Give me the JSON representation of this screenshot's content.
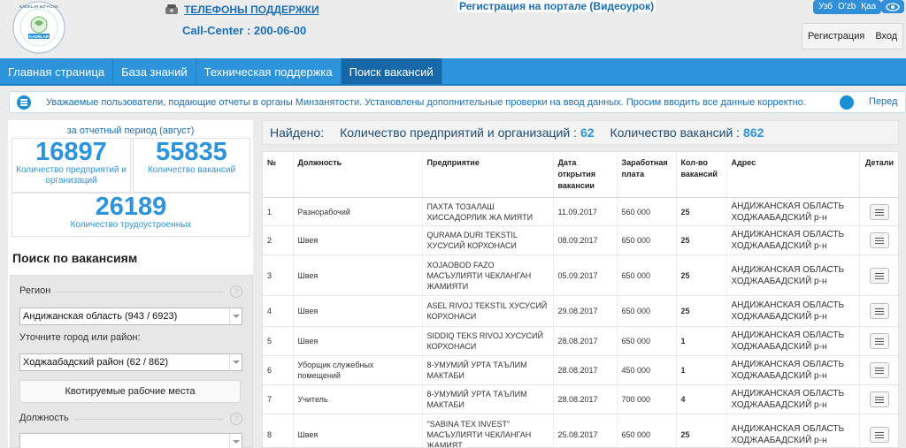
{
  "header": {
    "logo_text_top": "KADRLAR BO'YICHA",
    "logo_text_mid": "KADRLAR",
    "support_link": "ТЕЛЕФОНЫ ПОДДЕРЖКИ",
    "callcenter": "Call-Center : 200-06-00",
    "video_link": "Регистрация на портале (Видеоурок)",
    "langs": [
      "Узб",
      "O'zb",
      "Қаа"
    ],
    "register": "Регистрация",
    "login": "Вход"
  },
  "nav": {
    "items": [
      "Главная страница",
      "База знаний",
      "Техническая поддержка",
      "Поиск вакансий"
    ],
    "active_index": 3
  },
  "notice": {
    "text": "Уважаемые пользователи, подающие отчеты в органы Минзанятости. Установлены дополнительные проверки на ввод данных. Просим вводить все данные корректно.",
    "more": "Перед"
  },
  "stats": {
    "period": "за отчетный период (август)",
    "enterprises_count": "16897",
    "enterprises_label": "Количество предприятий и организаций",
    "vacancies_count": "55835",
    "vacancies_label": "Количество вакансий",
    "employed_count": "26189",
    "employed_label": "Количество трудоустроенных"
  },
  "search": {
    "title": "Поиск по вакансиям",
    "region_label": "Регион",
    "region_value": "Андижанская область (943 / 6923)",
    "city_label": "Уточните город или район:",
    "city_value": "Ходжаабадский район (62 / 862)",
    "quota_button": "Квотируемые рабочие места",
    "position_label": "Должность",
    "position_value": ""
  },
  "found": {
    "label": "Найдено:",
    "enterprises_label": "Количество предприятий и организаций :",
    "enterprises_value": "62",
    "vacancies_label": "Количество вакансий :",
    "vacancies_value": "862"
  },
  "table": {
    "headers": [
      "№",
      "Должность",
      "Предприятие",
      "Дата открытия вакансии",
      "Заработная плата",
      "Кол-во вакансий",
      "Адрес",
      "Детали"
    ],
    "rows": [
      {
        "num": "1",
        "position": "Разнорабочий",
        "company": "ПАХТА ТОЗАЛАШ ХИССАДОРЛИК ЖА МИЯТИ",
        "date": "11.09.2017",
        "salary": "560 000",
        "count": "25",
        "address": "АНДИЖАНСКАЯ ОБЛАСТЬ ХОДЖААБАДСКИЙ р-н"
      },
      {
        "num": "2",
        "position": "Швея",
        "company": "QURAMA DURI TEKSTIL ХУСУСИЙ КОРХОНАСИ",
        "date": "08.09.2017",
        "salary": "650 000",
        "count": "25",
        "address": "АНДИЖАНСКАЯ ОБЛАСТЬ ХОДЖААБАДСКИЙ р-н"
      },
      {
        "num": "3",
        "position": "Швея",
        "company": "XOJAOBOD FAZO МАСЪУЛИЯТИ ЧЕКЛАНГАН ЖАМИЯТИ",
        "date": "05.09.2017",
        "salary": "650 000",
        "count": "25",
        "address": "АНДИЖАНСКАЯ ОБЛАСТЬ ХОДЖААБАДСКИЙ р-н"
      },
      {
        "num": "4",
        "position": "Швея",
        "company": "ASEL RIVOJ TEKSTIL ХУСУСИЙ КОРХОНАСИ",
        "date": "29.08.2017",
        "salary": "650 000",
        "count": "25",
        "address": "АНДИЖАНСКАЯ ОБЛАСТЬ ХОДЖААБАДСКИЙ р-н"
      },
      {
        "num": "5",
        "position": "Швея",
        "company": "SIDDIQ TEKS RIVOJ ХУСУСИЙ КОРХОНАСИ",
        "date": "28.08.2017",
        "salary": "650 000",
        "count": "1",
        "address": "АНДИЖАНСКАЯ ОБЛАСТЬ ХОДЖААБАДСКИЙ р-н"
      },
      {
        "num": "6",
        "position": "Уборщик служебных помещений",
        "company": "8-УМУМИЙ УРТА ТАЪЛИМ МАКТАБИ",
        "date": "28.08.2017",
        "salary": "450 000",
        "count": "1",
        "address": "АНДИЖАНСКАЯ ОБЛАСТЬ ХОДЖААБАДСКИЙ р-н"
      },
      {
        "num": "7",
        "position": "Учитель",
        "company": "8-УМУМИЙ УРТА ТАЪЛИМ МАКТАБИ",
        "date": "28.08.2017",
        "salary": "700 000",
        "count": "4",
        "address": "АНДИЖАНСКАЯ ОБЛАСТЬ ХОДЖААБАДСКИЙ р-н"
      },
      {
        "num": "8",
        "position": "Швея",
        "company": "\"SABINA TEX INVEST\" МАСЪУЛИЯТИ ЧЕКЛАНГАН ЖАМИЯТ",
        "date": "25.08.2017",
        "salary": "650 000",
        "count": "25",
        "address": "АНДИЖАНСКАЯ ОБЛАСТЬ ХОДЖААБАДСКИЙ р-н"
      }
    ]
  }
}
